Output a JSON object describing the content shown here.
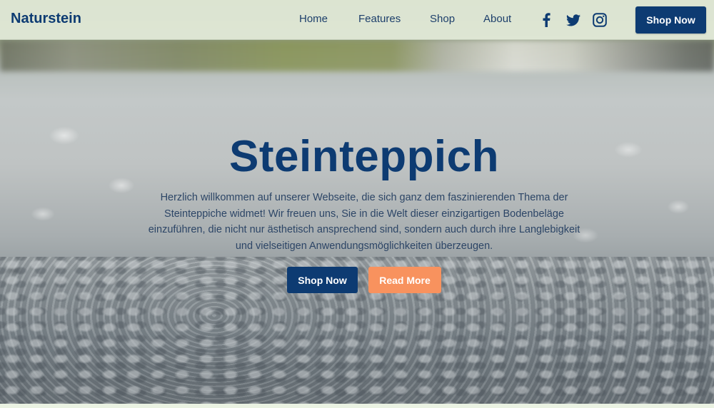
{
  "brand": {
    "name": "Naturstein"
  },
  "nav": {
    "links": [
      {
        "label": "Home"
      },
      {
        "label": "Features"
      },
      {
        "label": "Shop"
      },
      {
        "label": "About"
      }
    ],
    "social": [
      {
        "icon": "facebook-icon"
      },
      {
        "icon": "twitter-icon"
      },
      {
        "icon": "instagram-icon"
      }
    ],
    "cta_label": "Shop Now"
  },
  "hero": {
    "title": "Steinteppich",
    "text": "Herzlich willkommen auf unserer Webseite, die sich ganz dem faszinierenden Thema der Steinteppiche widmet! Wir freuen uns, Sie in die Welt dieser einzigartigen Bodenbeläge einzuführen, die nicht nur ästhetisch ansprechend sind, sondern auch durch ihre Langlebigkeit und vielseitigen Anwendungsmöglichkeiten überzeugen.",
    "primary_button": "Shop Now",
    "secondary_button": "Read More"
  },
  "colors": {
    "primary": "#0d3b72",
    "accent": "#f8925e",
    "navbar_bg": "#e4ecda"
  }
}
